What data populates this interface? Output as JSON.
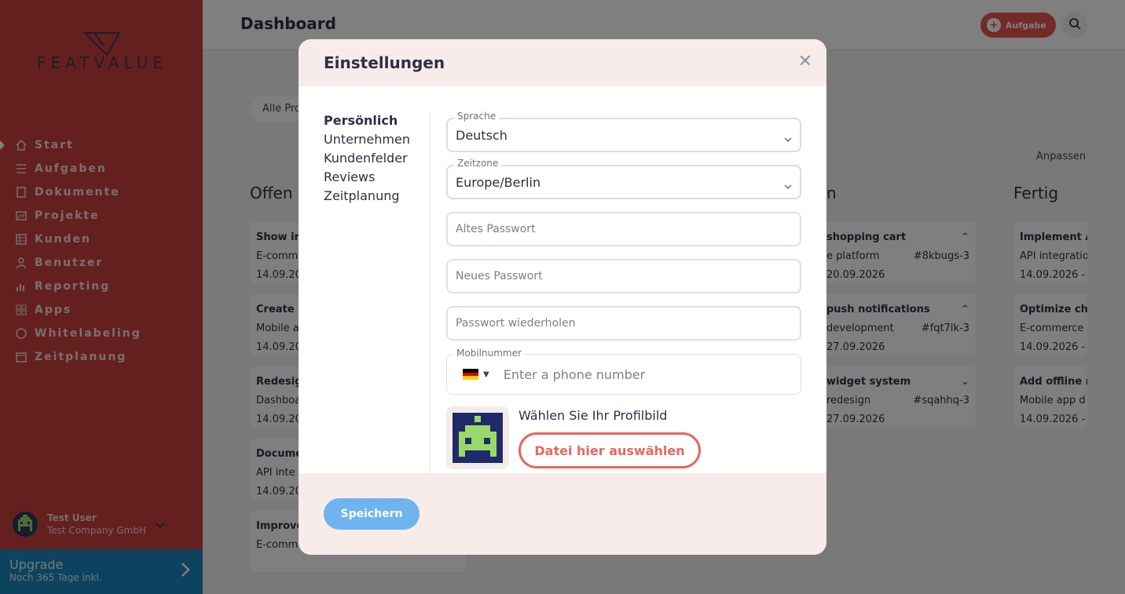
{
  "brand": {
    "logo_text": "FEATVALUE"
  },
  "sidebar": {
    "items": [
      {
        "label": "Start",
        "icon": "home-icon"
      },
      {
        "label": "Aufgaben",
        "icon": "tasks-icon"
      },
      {
        "label": "Dokumente",
        "icon": "document-icon"
      },
      {
        "label": "Projekte",
        "icon": "project-icon"
      },
      {
        "label": "Kunden",
        "icon": "customers-icon"
      },
      {
        "label": "Benutzer",
        "icon": "user-icon"
      },
      {
        "label": "Reporting",
        "icon": "chart-icon"
      },
      {
        "label": "Apps",
        "icon": "apps-icon"
      },
      {
        "label": "Whitelabeling",
        "icon": "palette-icon"
      },
      {
        "label": "Zeitplanung",
        "icon": "calendar-icon"
      }
    ],
    "user": {
      "name": "Test User",
      "company": "Test Company GmbH"
    },
    "upgrade": {
      "title": "Upgrade",
      "subtitle": "Noch 365 Tage inkl."
    }
  },
  "header": {
    "title": "Dashboard",
    "task_button": "Aufgabe"
  },
  "board": {
    "filter": "Alle Projekte",
    "customize": "Anpassen",
    "columns": [
      {
        "title": "Offen",
        "cards": [
          {
            "title": "Show in",
            "project": "E-comm",
            "date": "14.09.202"
          },
          {
            "title": "Create i",
            "project": "Mobile a",
            "date": "14.09.202"
          },
          {
            "title": "Redesig",
            "project": "Dashboa",
            "date": "14.09.202"
          },
          {
            "title": "Docume",
            "project": "API inte",
            "date": "14.09.202"
          },
          {
            "title": "Improve",
            "project": "E-comm",
            "date": ""
          }
        ]
      },
      {
        "title": "n",
        "cards": [
          {
            "title": "shopping cart",
            "project": "e platform",
            "id": "#8kbugs-3",
            "date": "20.09.2026"
          },
          {
            "title": "push notifications",
            "project": "development",
            "id": "#fqt7lk-3",
            "date": "27.09.2026"
          },
          {
            "title": "widget system",
            "project": "redesign",
            "id": "#sqahhq-3",
            "date": "27.09.2026"
          }
        ]
      },
      {
        "title": "Fertig",
        "cards": [
          {
            "title": "Implement A",
            "project": "API integratio",
            "date": "14.09.2026 - 2"
          },
          {
            "title": "Optimize che",
            "project": "E-commerce",
            "date": "14.09.2026 - 2"
          },
          {
            "title": "Add offline n",
            "project": "Mobile app d",
            "date": "14.09.2026 - 2"
          }
        ]
      }
    ]
  },
  "modal": {
    "title": "Einstellungen",
    "tabs": [
      "Persönlich",
      "Unternehmen",
      "Kundenfelder",
      "Reviews",
      "Zeitplanung"
    ],
    "language": {
      "label": "Sprache",
      "value": "Deutsch"
    },
    "timezone": {
      "label": "Zeitzone",
      "value": "Europe/Berlin"
    },
    "old_password": {
      "placeholder": "Altes Passwort"
    },
    "new_password": {
      "placeholder": "Neues Passwort"
    },
    "repeat_password": {
      "placeholder": "Passwort wiederholen"
    },
    "phone": {
      "label": "Mobilnummer",
      "placeholder": "Enter a phone number"
    },
    "profile_pic": {
      "label": "Wählen Sie Ihr Profilbild",
      "button": "Datei hier auswählen"
    },
    "save": "Speichern"
  },
  "colors": {
    "sidebar": "#c8403e",
    "accent": "#e8554f",
    "save": "#6fb3ef",
    "upgrade": "#1d87bf"
  }
}
